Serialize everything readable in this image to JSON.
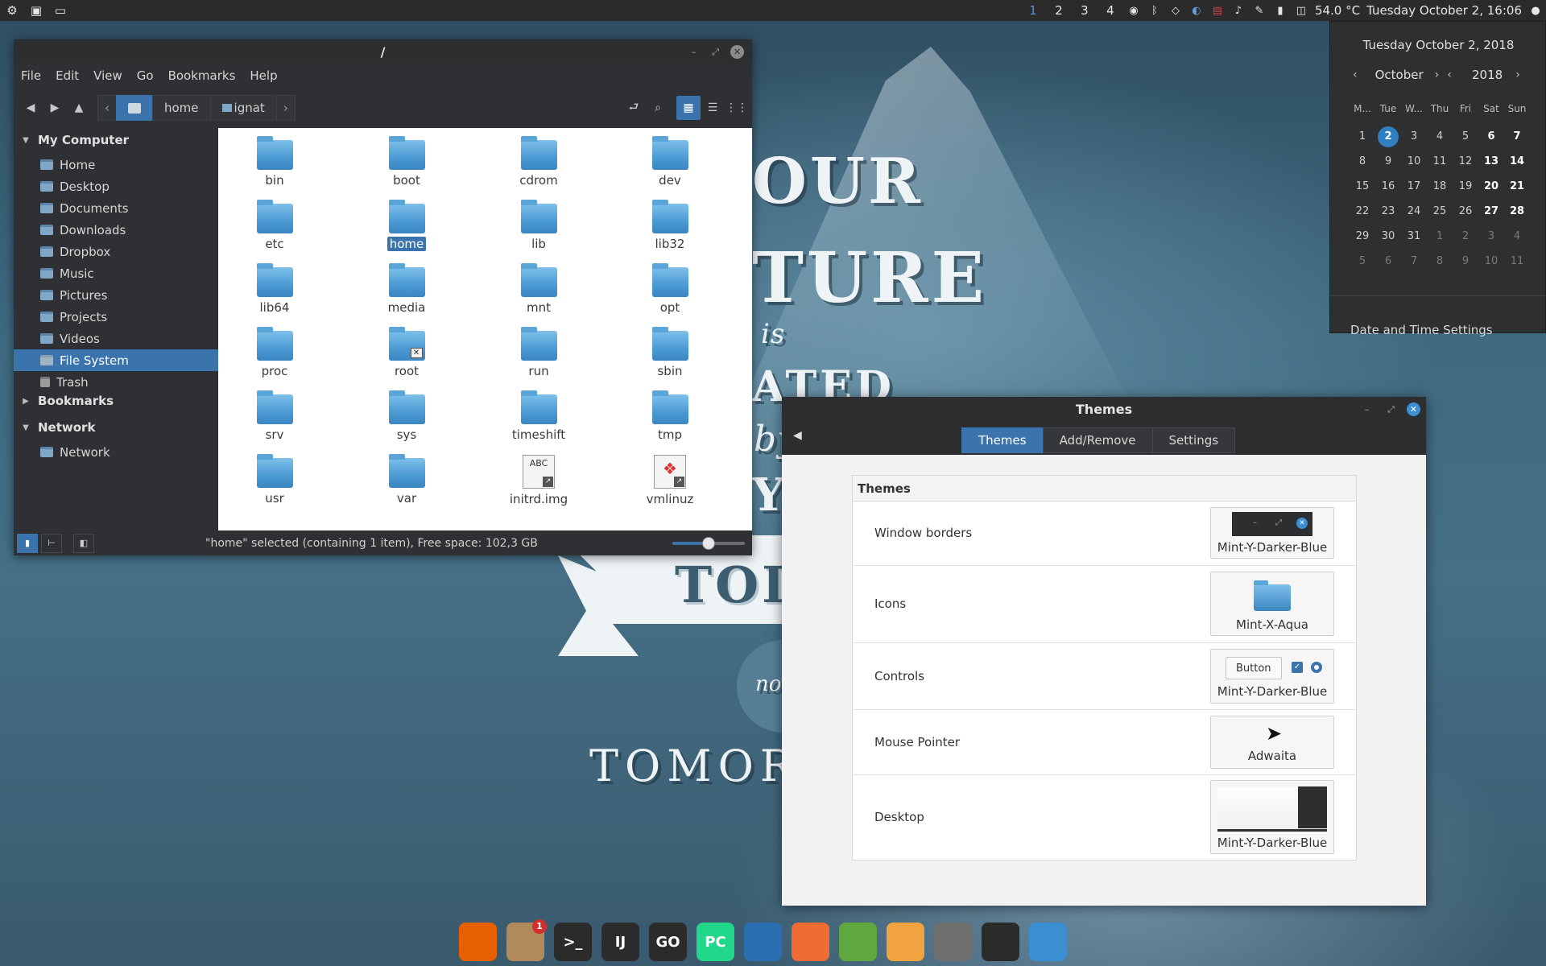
{
  "top_panel": {
    "workspaces": [
      {
        "label": "1",
        "active": true
      },
      {
        "label": "2",
        "active": false
      },
      {
        "label": "3",
        "active": false
      },
      {
        "label": "4",
        "active": false
      }
    ],
    "temperature": "54.0 °C",
    "clock": "Tuesday October  2, 16:06",
    "tray_icons": [
      "bluetooth-icon",
      "vpn-icon",
      "dropbox-icon",
      "intel-icon",
      "us-flag-icon",
      "music-icon",
      "pen-icon",
      "battery-icon",
      "system-monitor-icon"
    ]
  },
  "calendar": {
    "title": "Tuesday October 2, 2018",
    "month": "October",
    "year": "2018",
    "weekdays": [
      "M...",
      "Tue",
      "W...",
      "Thu",
      "Fri",
      "Sat",
      "Sun"
    ],
    "weeks": [
      [
        "1",
        "2",
        "3",
        "4",
        "5",
        "6",
        "7"
      ],
      [
        "8",
        "9",
        "10",
        "11",
        "12",
        "13",
        "14"
      ],
      [
        "15",
        "16",
        "17",
        "18",
        "19",
        "20",
        "21"
      ],
      [
        "22",
        "23",
        "24",
        "25",
        "26",
        "27",
        "28"
      ],
      [
        "29",
        "30",
        "31",
        "1",
        "2",
        "3",
        "4"
      ],
      [
        "5",
        "6",
        "7",
        "8",
        "9",
        "10",
        "11"
      ]
    ],
    "today": "2",
    "settings_label": "Date and Time Settings"
  },
  "file_manager": {
    "title": "/",
    "menu": [
      "File",
      "Edit",
      "View",
      "Go",
      "Bookmarks",
      "Help"
    ],
    "breadcrumbs": [
      "home",
      "ignat"
    ],
    "sidebar": {
      "my_computer": "My Computer",
      "my_computer_items": [
        "Home",
        "Desktop",
        "Documents",
        "Downloads",
        "Dropbox",
        "Music",
        "Pictures",
        "Projects",
        "Videos",
        "File System",
        "Trash"
      ],
      "selected": "File System",
      "bookmarks": "Bookmarks",
      "network": "Network",
      "network_items": [
        "Network"
      ]
    },
    "files": [
      "bin",
      "boot",
      "cdrom",
      "dev",
      "etc",
      "home",
      "lib",
      "lib32",
      "lib64",
      "media",
      "mnt",
      "opt",
      "proc",
      "root",
      "run",
      "sbin",
      "srv",
      "sys",
      "timeshift",
      "tmp",
      "usr",
      "var",
      "initrd.img",
      "vmlinuz"
    ],
    "selected_file": "home",
    "initrd_badge": "ABC",
    "status": "\"home\" selected (containing 1 item), Free space: 102,3 GB",
    "zoom_level": 0.5
  },
  "themes_window": {
    "title": "Themes",
    "tabs": [
      "Themes",
      "Add/Remove",
      "Settings"
    ],
    "active_tab": "Themes",
    "section_title": "Themes",
    "rows": [
      {
        "label": "Window borders",
        "value": "Mint-Y-Darker-Blue"
      },
      {
        "label": "Icons",
        "value": "Mint-X-Aqua"
      },
      {
        "label": "Controls",
        "value": "Mint-Y-Darker-Blue"
      },
      {
        "label": "Mouse Pointer",
        "value": "Adwaita"
      },
      {
        "label": "Desktop",
        "value": "Mint-Y-Darker-Blue"
      }
    ],
    "controls_preview_button": "Button"
  },
  "wallpaper": {
    "lines": [
      "OUR",
      "TURE",
      "is",
      "ATED",
      "by",
      "Y",
      "TOD",
      "not",
      "TOMOR"
    ]
  },
  "dock": {
    "apps": [
      {
        "name": "firefox",
        "label": "",
        "color": "#e66000"
      },
      {
        "name": "mail",
        "label": "",
        "color": "#b08a5a",
        "badge": "1"
      },
      {
        "name": "terminal",
        "label": ">_",
        "color": "#2b2b2b"
      },
      {
        "name": "intellij",
        "label": "IJ",
        "color": "#2b2b2b"
      },
      {
        "name": "goland",
        "label": "GO",
        "color": "#2b2b2b"
      },
      {
        "name": "pycharm",
        "label": "PC",
        "color": "#21d789"
      },
      {
        "name": "vscode",
        "label": "",
        "color": "#2b6fb0"
      },
      {
        "name": "postman",
        "label": "",
        "color": "#ef6c33"
      },
      {
        "name": "keepass",
        "label": "",
        "color": "#5ea83f"
      },
      {
        "name": "sublime",
        "label": "",
        "color": "#f0a33e"
      },
      {
        "name": "settings",
        "label": "",
        "color": "#6f6f6f"
      },
      {
        "name": "system-monitor",
        "label": "",
        "color": "#2b2b2b"
      },
      {
        "name": "files",
        "label": "",
        "color": "#3b8fd0"
      }
    ]
  },
  "colors": {
    "accent": "#3b74ad",
    "panel": "#2b2b2b",
    "titlebar": "#2d2e30"
  }
}
